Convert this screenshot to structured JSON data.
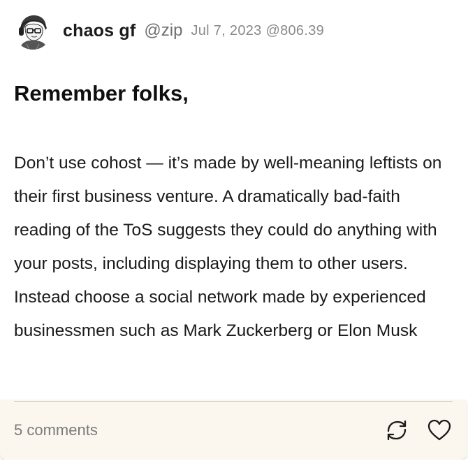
{
  "post": {
    "author": {
      "display_name": "chaos gf",
      "handle": "@zip",
      "avatar_icon": "avatar-portrait-icon"
    },
    "timestamp": "Jul 7, 2023 @806.39",
    "headline": "Remember folks,",
    "body": "Don’t use cohost — it’s made by well-meaning leftists on their first business venture. A dramatically bad-faith reading of the ToS suggests they could do anything with your posts, including displaying them to other users. Instead choose a social network made by experienced businessmen such as Mark Zuckerberg or Elon Musk",
    "footer": {
      "comments_label": "5 comments",
      "background": "#fbf6ee"
    },
    "actions": [
      {
        "icon": "repost-icon"
      },
      {
        "icon": "heart-icon"
      }
    ]
  }
}
